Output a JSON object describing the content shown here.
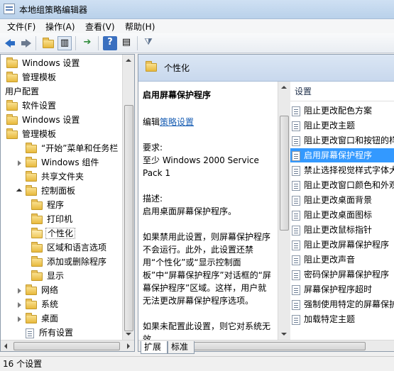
{
  "window": {
    "title": "本地组策略编辑器"
  },
  "menu": [
    {
      "label": "文件(F)"
    },
    {
      "label": "操作(A)"
    },
    {
      "label": "查看(V)"
    },
    {
      "label": "帮助(H)"
    }
  ],
  "toolbar": {
    "icons": [
      "back-icon",
      "forward-icon",
      "up-folder-icon",
      "show-hide-tree-icon",
      "export-list-icon",
      "help-icon",
      "extended-view-icon",
      "filter-icon"
    ]
  },
  "tree": {
    "items": [
      {
        "label": "Windows 设置",
        "level": 1,
        "icon": "folder",
        "twisty": "none"
      },
      {
        "label": "管理模板",
        "level": 1,
        "icon": "folder",
        "twisty": "none"
      },
      {
        "label": "用户配置",
        "level": 0,
        "icon": "none",
        "twisty": "none"
      },
      {
        "label": "软件设置",
        "level": 1,
        "icon": "folder",
        "twisty": "none"
      },
      {
        "label": "Windows 设置",
        "level": 1,
        "icon": "folder",
        "twisty": "none"
      },
      {
        "label": "管理模板",
        "level": 1,
        "icon": "folder",
        "twisty": "none"
      },
      {
        "label": "“开始”菜单和任务栏",
        "level": 2,
        "icon": "folder",
        "twisty": "none"
      },
      {
        "label": "Windows 组件",
        "level": 2,
        "icon": "folder",
        "twisty": "closed"
      },
      {
        "label": "共享文件夹",
        "level": 2,
        "icon": "folder",
        "twisty": "none"
      },
      {
        "label": "控制面板",
        "level": 2,
        "icon": "folder",
        "twisty": "open"
      },
      {
        "label": "程序",
        "level": 3,
        "icon": "folder",
        "twisty": "none"
      },
      {
        "label": "打印机",
        "level": 3,
        "icon": "folder",
        "twisty": "none"
      },
      {
        "label": "个性化",
        "level": 3,
        "icon": "folder-open",
        "twisty": "none",
        "selected": true
      },
      {
        "label": "区域和语言选项",
        "level": 3,
        "icon": "folder",
        "twisty": "none"
      },
      {
        "label": "添加或删除程序",
        "level": 3,
        "icon": "folder",
        "twisty": "none"
      },
      {
        "label": "显示",
        "level": 3,
        "icon": "folder",
        "twisty": "none"
      },
      {
        "label": "网络",
        "level": 2,
        "icon": "folder",
        "twisty": "closed"
      },
      {
        "label": "系统",
        "level": 2,
        "icon": "folder",
        "twisty": "closed"
      },
      {
        "label": "桌面",
        "level": 2,
        "icon": "folder",
        "twisty": "closed"
      },
      {
        "label": "所有设置",
        "level": 2,
        "icon": "settings",
        "twisty": "none"
      }
    ]
  },
  "right": {
    "folder_title": "个性化",
    "policy_title": "启用屏幕保护程序",
    "edit_prefix": "编辑",
    "edit_link": "策略设置",
    "requirements_label": "要求:",
    "requirements_value": "至少 Windows 2000 Service Pack 1",
    "description_label": "描述:",
    "description_value": "启用桌面屏幕保护程序。",
    "para1": "如果禁用此设置，则屏幕保护程序不会运行。此外，此设置还禁用“个性化”或“显示控制面板”中“屏幕保护程序”对话框的“屏幕保护程序”区域。这样，用户就无法更改屏幕保护程序选项。",
    "para2": "如果未配置此设置，则它对系统无效。",
    "list_header": "设置",
    "list": [
      "阻止更改配色方案",
      "阻止更改主题",
      "阻止更改窗口和按钮的样式",
      "启用屏幕保护程序",
      "禁止选择视觉样式字体大小",
      "阻止更改窗口颜色和外观",
      "阻止更改桌面背景",
      "阻止更改桌面图标",
      "阻止更改鼠标指针",
      "阻止更改屏幕保护程序",
      "阻止更改声音",
      "密码保护屏幕保护程序",
      "屏幕保护程序超时",
      "强制使用特定的屏幕保护程序",
      "加载特定主题"
    ],
    "selected_index": 3
  },
  "tabs": [
    {
      "label": "扩展"
    },
    {
      "label": "标准"
    }
  ],
  "status": {
    "text": "16 个设置"
  }
}
